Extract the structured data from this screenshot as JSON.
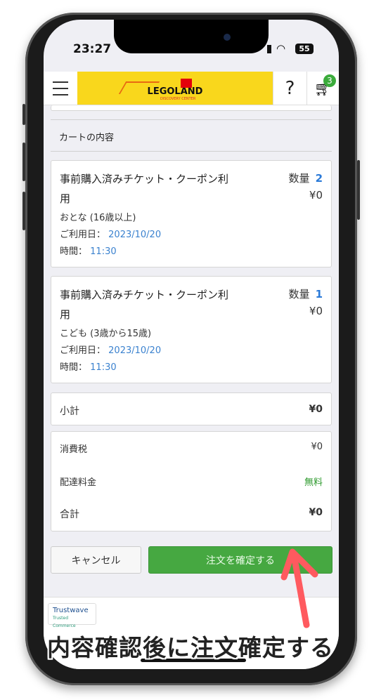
{
  "status_bar": {
    "time": "23:27",
    "battery": "55"
  },
  "header": {
    "logo_text": "LEGOLAND",
    "logo_sub": "DISCOVERY CENTER",
    "help": "?",
    "cart_count": "3"
  },
  "section_title": "カートの内容",
  "items": [
    {
      "name": "事前購入済みチケット・クーポン利用",
      "qty_label": "数量",
      "qty": "2",
      "price": "¥0",
      "type": "おとな (16歳以上)",
      "date_label": "ご利用日：",
      "date": "2023/10/20",
      "time_label": "時間：",
      "time": "11:30"
    },
    {
      "name": "事前購入済みチケット・クーポン利用",
      "qty_label": "数量",
      "qty": "1",
      "price": "¥0",
      "type": "こども (3歳から15歳)",
      "date_label": "ご利用日：",
      "date": "2023/10/20",
      "time_label": "時間：",
      "time": "11:30"
    }
  ],
  "subtotal": {
    "label": "小計",
    "value": "¥0"
  },
  "summary": {
    "tax_label": "消費税",
    "tax": "¥0",
    "shipping_label": "配達料金",
    "shipping": "無料",
    "total_label": "合計",
    "total": "¥0"
  },
  "buttons": {
    "cancel": "キャンセル",
    "confirm": "注文を確定する"
  },
  "footer": {
    "trust": "Trustwave",
    "trust_sub": "Trusted Commerce"
  },
  "overlay_caption": "内容確認後に注文確定する",
  "colors": {
    "accent_green": "#46a841",
    "link_blue": "#3b82cf",
    "logo_yellow": "#f9d71c",
    "arrow_red": "#ff5a5f"
  }
}
